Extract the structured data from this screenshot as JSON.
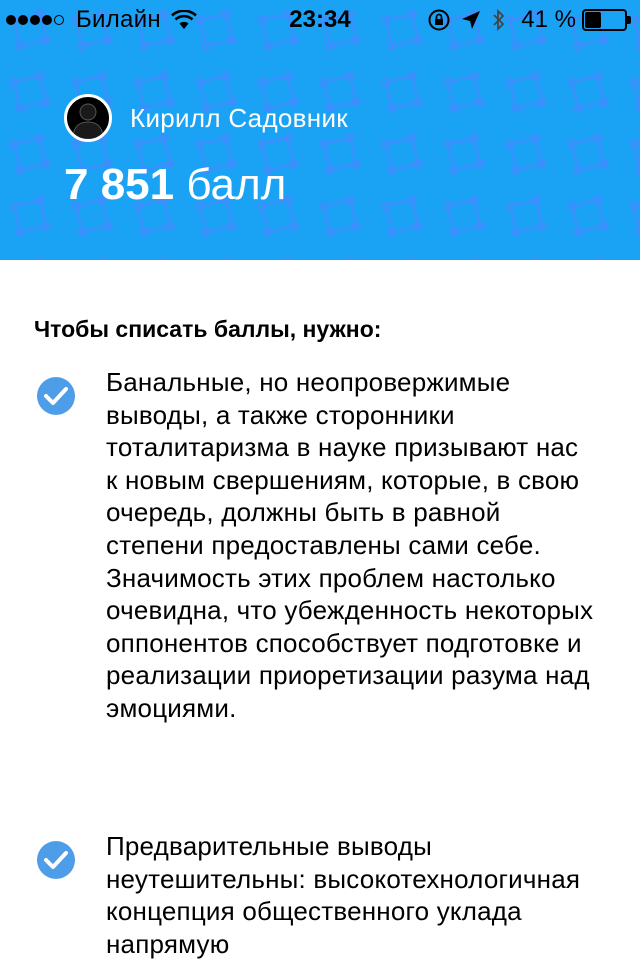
{
  "status_bar": {
    "carrier": "Билайн",
    "time": "23:34",
    "battery_percent": "41 %",
    "battery_level": 0.41,
    "signal_bars_filled": 4,
    "signal_bars_total": 5
  },
  "profile": {
    "name": "Кирилл Садовник",
    "points_value": "7 851",
    "points_unit": "балл"
  },
  "main": {
    "title": "Чтобы списать баллы, нужно:",
    "items": [
      {
        "icon": "check-circle-icon",
        "text": "Банальные, но неопровержимые выводы, а также сторонники тоталитаризма в науке призывают нас к новым свершениям, которые, в свою очередь, должны быть в равной степени предоставлены сами себе. Значимость этих проблем настолько очевидна, что убежденность некоторых оппонентов способствует подготовке и реализации приоретизации разума над эмоциями."
      },
      {
        "icon": "check-circle-icon",
        "text": "Предварительные выводы неутешительны: высокотехнологичная концепция общественного уклада напрямую"
      }
    ]
  },
  "colors": {
    "header_bg": "#1aa3f4",
    "pattern": "#3b8bff",
    "check": "#4d9de8"
  }
}
